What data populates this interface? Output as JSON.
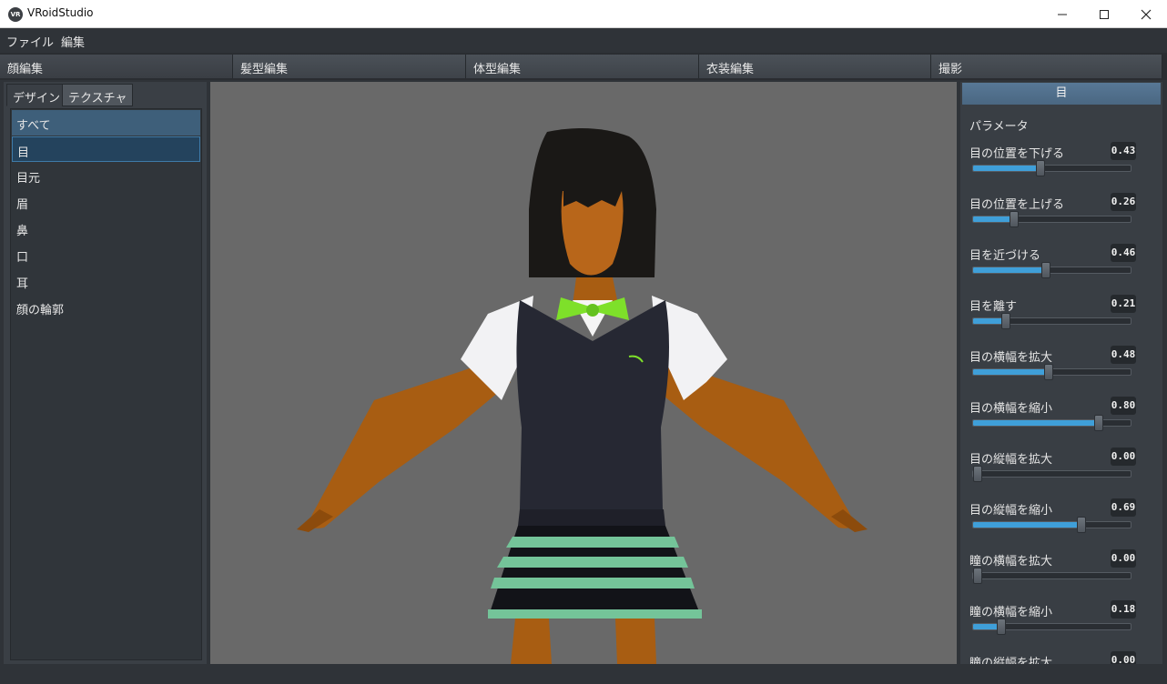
{
  "window": {
    "logo_text": "VR",
    "title": "VRoidStudio"
  },
  "menu": [
    "ファイル",
    "編集"
  ],
  "mode_tabs": [
    "顔編集",
    "髪型編集",
    "体型編集",
    "衣装編集",
    "撮影"
  ],
  "sub_tabs": [
    "デザイン",
    "テクスチャ"
  ],
  "categories": [
    "すべて",
    "目",
    "目元",
    "眉",
    "鼻",
    "口",
    "耳",
    "顔の輪郭"
  ],
  "selected_category": "目",
  "panel": {
    "title": "目",
    "section": "パラメータ",
    "params": [
      {
        "label": "目の位置を下げる",
        "value": "0.43",
        "level": 0.43
      },
      {
        "label": "目の位置を上げる",
        "value": "0.26",
        "level": 0.26
      },
      {
        "label": "目を近づける",
        "value": "0.46",
        "level": 0.46
      },
      {
        "label": "目を離す",
        "value": "0.21",
        "level": 0.21
      },
      {
        "label": "目の横幅を拡大",
        "value": "0.48",
        "level": 0.48
      },
      {
        "label": "目の横幅を縮小",
        "value": "0.80",
        "level": 0.8
      },
      {
        "label": "目の縦幅を拡大",
        "value": "0.00",
        "level": 0.0
      },
      {
        "label": "目の縦幅を縮小",
        "value": "0.69",
        "level": 0.69
      },
      {
        "label": "瞳の横幅を拡大",
        "value": "0.00",
        "level": 0.0
      },
      {
        "label": "瞳の横幅を縮小",
        "value": "0.18",
        "level": 0.18
      },
      {
        "label": "瞳の縦幅を拡大",
        "value": "0.00",
        "level": 0.0
      }
    ]
  },
  "colors": {
    "accent": "#3f9fd9",
    "viewport_bg": "#696969",
    "panel_bg": "#393e44"
  }
}
